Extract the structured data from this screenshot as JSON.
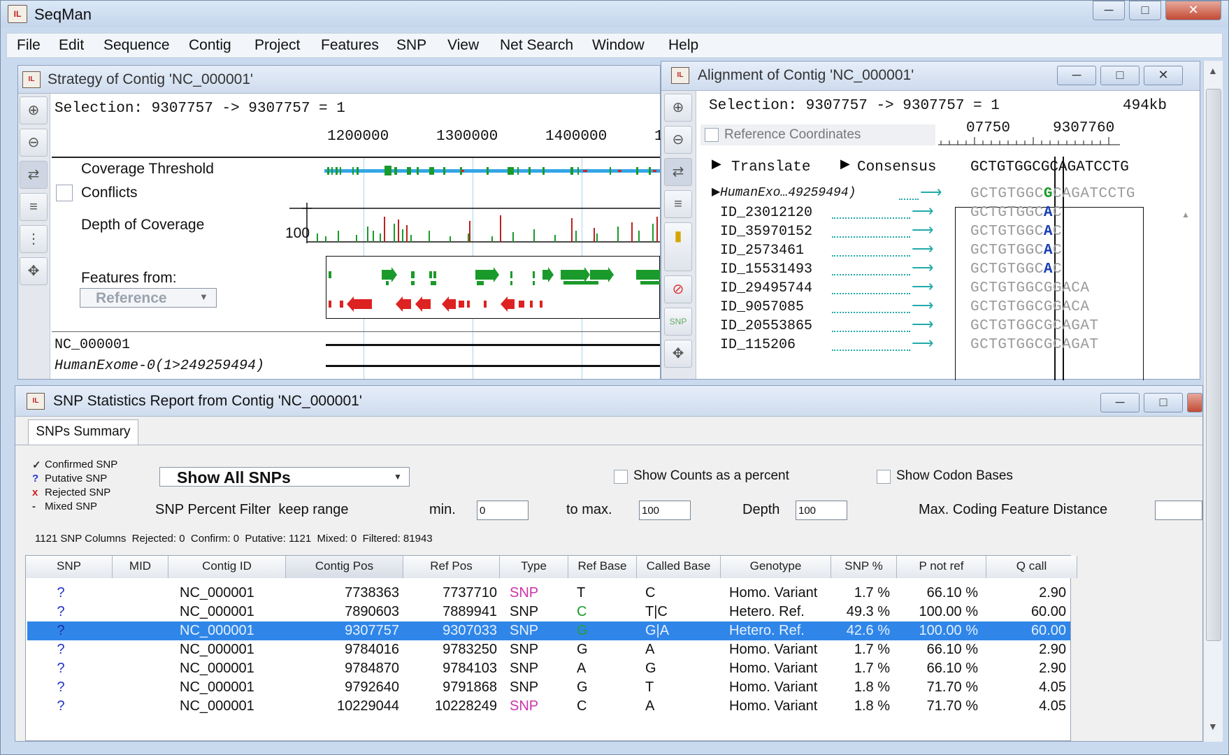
{
  "app": {
    "title": "SeqMan",
    "icon": "seqman-app-icon"
  },
  "menu": [
    "File",
    "Edit",
    "Sequence",
    "Contig",
    "Project",
    "Features",
    "SNP",
    "View",
    "Net Search",
    "Window",
    "Help"
  ],
  "strategy": {
    "title": "Strategy of Contig 'NC_000001'",
    "selection": "Selection: 9307757 -> 9307757 = 1",
    "ruler_ticks": [
      "1200000",
      "1300000",
      "1400000",
      "1"
    ],
    "coverage_threshold": "Coverage Threshold",
    "conflicts": "Conflicts",
    "depth_of_coverage": "Depth of Coverage",
    "depth_value": "100",
    "features_from": "Features from:",
    "reference_select": "Reference",
    "tracks": [
      "NC_000001",
      "HumanExome-0(1>249259494)"
    ]
  },
  "alignment": {
    "title": "Alignment of Contig 'NC_000001'",
    "selection": "Selection: 9307757 -> 9307757 = 1",
    "size": "494kb",
    "reference_coordinates": "Reference Coordinates",
    "ruler_ticks": [
      "07750",
      "9307760"
    ],
    "translate": "Translate",
    "consensus": "Consensus",
    "consensus_seq": "GCTGTGGCGCAGATCCTG",
    "reads": [
      {
        "name": "HumanExo…49259494)",
        "seq": "GCTGTGGCGCAGATCCTG",
        "called": "G"
      },
      {
        "name": "ID_23012120",
        "seq": "GCTGTGGCAC",
        "called": "A"
      },
      {
        "name": "ID_35970152",
        "seq": "GCTGTGGCAC",
        "called": "A"
      },
      {
        "name": "ID_2573461",
        "seq": "GCTGTGGCAC",
        "called": "A"
      },
      {
        "name": "ID_15531493",
        "seq": "GCTGTGGCAC",
        "called": "A"
      },
      {
        "name": "ID_29495744",
        "seq": "GCTGTGGCGGACA",
        "called": ""
      },
      {
        "name": "ID_9057085",
        "seq": "GCTGTGGCGGACA",
        "called": ""
      },
      {
        "name": "ID_20553865",
        "seq": "GCTGTGGCGCAGAT",
        "called": ""
      },
      {
        "name": "ID_115206",
        "seq": "GCTGTGGCGCAGAT",
        "called": ""
      }
    ]
  },
  "snp_report": {
    "title": "SNP Statistics Report from Contig 'NC_000001'",
    "tab": "SNPs Summary",
    "legend": [
      {
        "sym": "✓",
        "label": "Confirmed SNP",
        "color": "#333333"
      },
      {
        "sym": "?",
        "label": "Putative SNP",
        "color": "#2233cc"
      },
      {
        "sym": "x",
        "label": "Rejected SNP",
        "color": "#cc2222"
      },
      {
        "sym": "-",
        "label": "Mixed SNP",
        "color": "#333333"
      }
    ],
    "show_select": "Show All SNPs",
    "show_counts_percent": "Show Counts as a percent",
    "show_codon_bases": "Show Codon Bases",
    "percent_filter": "SNP Percent Filter  keep range",
    "min_label": "min.",
    "min_value": "0",
    "max_label": "to max.",
    "max_value": "100",
    "depth_label": "Depth",
    "depth_value": "100",
    "coding_distance_label": "Max. Coding Feature Distance",
    "coding_distance_value": "",
    "summary": "1121 SNP Columns  Rejected: 0  Confirm: 0  Putative: 1121  Mixed: 0  Filtered: 81943",
    "columns": [
      "SNP",
      "MID",
      "Contig ID",
      "Contig Pos",
      "Ref Pos",
      "Type",
      "Ref Base",
      "Called Base",
      "Genotype",
      "SNP %",
      "P not ref",
      "Q call"
    ],
    "rows": [
      {
        "snp": "?",
        "mid": "",
        "contig": "NC_000001",
        "cpos": "7738363",
        "rpos": "7737710",
        "type": "SNP",
        "type_color": "#cc33aa",
        "ref": "T",
        "ref_color": "#111111",
        "called": "C",
        "geno": "Homo. Variant",
        "pct": "1.7 %",
        "pnot": "66.10 %",
        "q": "2.90",
        "selected": false
      },
      {
        "snp": "?",
        "mid": "",
        "contig": "NC_000001",
        "cpos": "7890603",
        "rpos": "7889941",
        "type": "SNP",
        "type_color": "#111111",
        "ref": "C",
        "ref_color": "#1a9a2a",
        "called": "T|C",
        "geno": "Hetero. Ref.",
        "pct": "49.3 %",
        "pnot": "100.00 %",
        "q": "60.00",
        "selected": false
      },
      {
        "snp": "?",
        "mid": "",
        "contig": "NC_000001",
        "cpos": "9307757",
        "rpos": "9307033",
        "type": "SNP",
        "type_color": "#e6f0ff",
        "ref": "G",
        "ref_color": "#2e9b3a",
        "called": "G|A",
        "geno": "Hetero. Ref.",
        "pct": "42.6 %",
        "pnot": "100.00 %",
        "q": "60.00",
        "selected": true
      },
      {
        "snp": "?",
        "mid": "",
        "contig": "NC_000001",
        "cpos": "9784016",
        "rpos": "9783250",
        "type": "SNP",
        "type_color": "#111111",
        "ref": "G",
        "ref_color": "#111111",
        "called": "A",
        "geno": "Homo. Variant",
        "pct": "1.7 %",
        "pnot": "66.10 %",
        "q": "2.90",
        "selected": false
      },
      {
        "snp": "?",
        "mid": "",
        "contig": "NC_000001",
        "cpos": "9784870",
        "rpos": "9784103",
        "type": "SNP",
        "type_color": "#111111",
        "ref": "A",
        "ref_color": "#111111",
        "called": "G",
        "geno": "Homo. Variant",
        "pct": "1.7 %",
        "pnot": "66.10 %",
        "q": "2.90",
        "selected": false
      },
      {
        "snp": "?",
        "mid": "",
        "contig": "NC_000001",
        "cpos": "9792640",
        "rpos": "9791868",
        "type": "SNP",
        "type_color": "#111111",
        "ref": "G",
        "ref_color": "#111111",
        "called": "T",
        "geno": "Homo. Variant",
        "pct": "1.8 %",
        "pnot": "71.70 %",
        "q": "4.05",
        "selected": false
      },
      {
        "snp": "?",
        "mid": "",
        "contig": "NC_000001",
        "cpos": "10229044",
        "rpos": "10228249",
        "type": "SNP",
        "type_color": "#cc33aa",
        "ref": "C",
        "ref_color": "#111111",
        "called": "A",
        "geno": "Homo. Variant",
        "pct": "1.8 %",
        "pnot": "71.70 %",
        "q": "4.05",
        "selected": false
      }
    ]
  }
}
